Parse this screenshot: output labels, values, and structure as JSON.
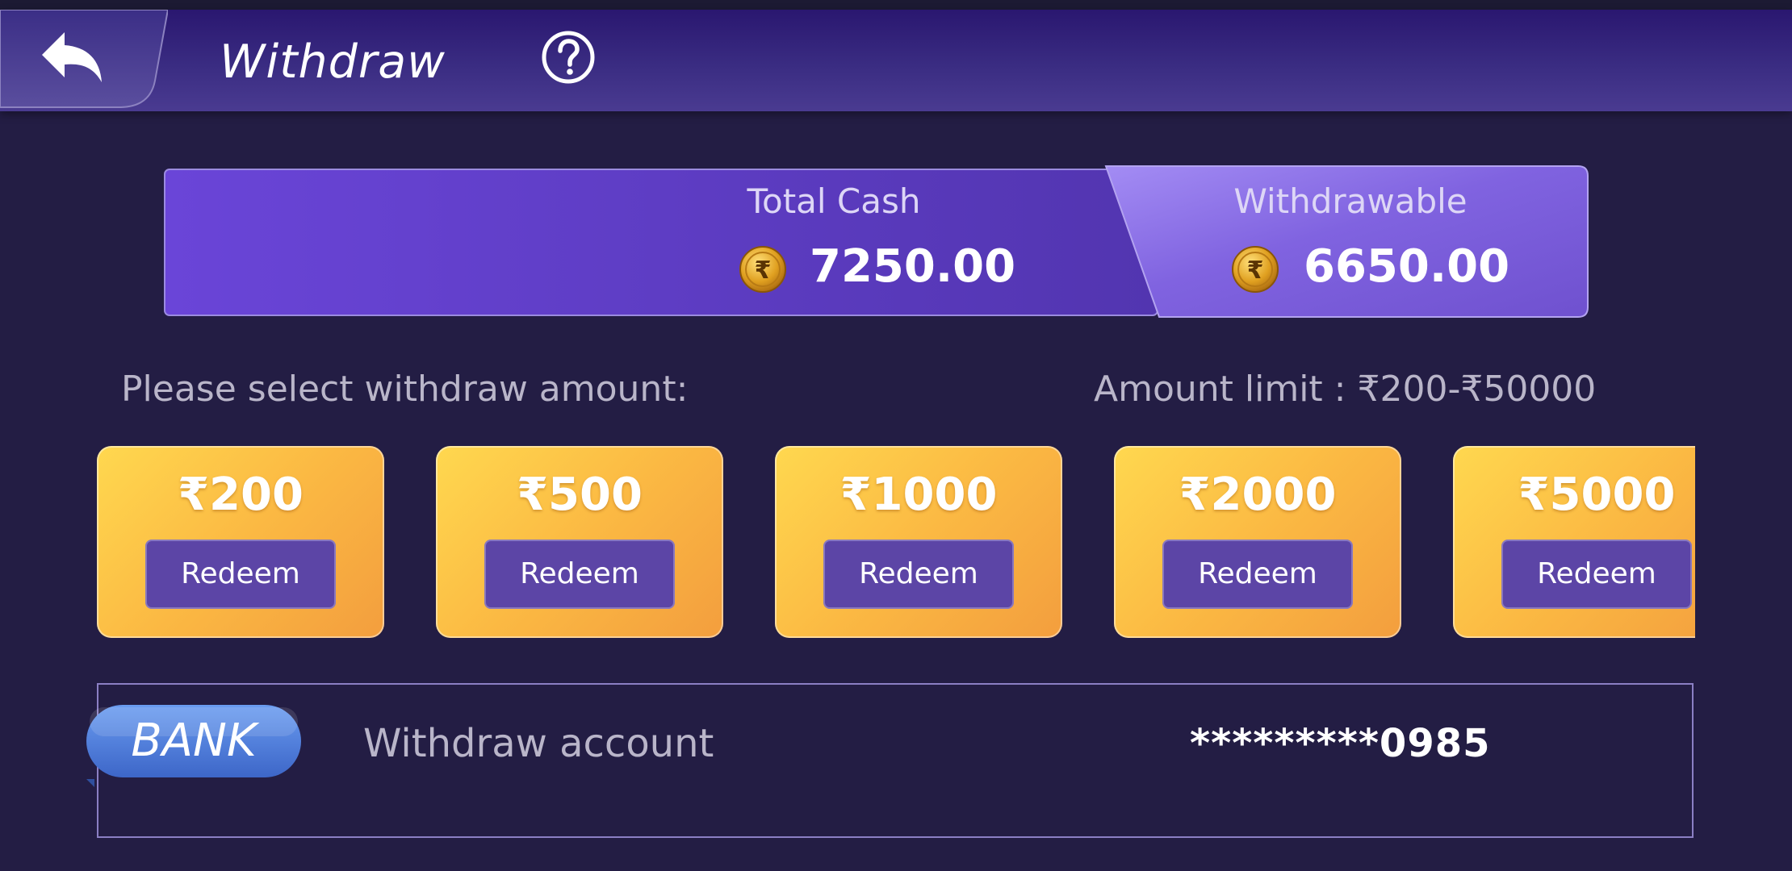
{
  "header": {
    "title": "Withdraw"
  },
  "balance": {
    "total_cash_label": "Total Cash",
    "total_cash_value": "7250.00",
    "withdrawable_label": "Withdrawable",
    "withdrawable_value": "6650.00",
    "coin_symbol": "₹"
  },
  "selection": {
    "prompt": "Please select withdraw amount:",
    "limit": "Amount limit : ₹200-₹50000"
  },
  "amounts": [
    {
      "value": "₹200",
      "button": "Redeem"
    },
    {
      "value": "₹500",
      "button": "Redeem"
    },
    {
      "value": "₹1000",
      "button": "Redeem"
    },
    {
      "value": "₹2000",
      "button": "Redeem"
    },
    {
      "value": "₹5000",
      "button": "Redeem"
    }
  ],
  "account": {
    "tag": "BANK",
    "label": "Withdraw account",
    "number": "*********0985"
  },
  "colors": {
    "background": "#231d44",
    "header": "#2a1770",
    "card_gradient_start": "#ffd84f",
    "card_gradient_end": "#f39e3e",
    "redeem_button": "#5c45a6",
    "bank_tag": "#4a78d8"
  }
}
